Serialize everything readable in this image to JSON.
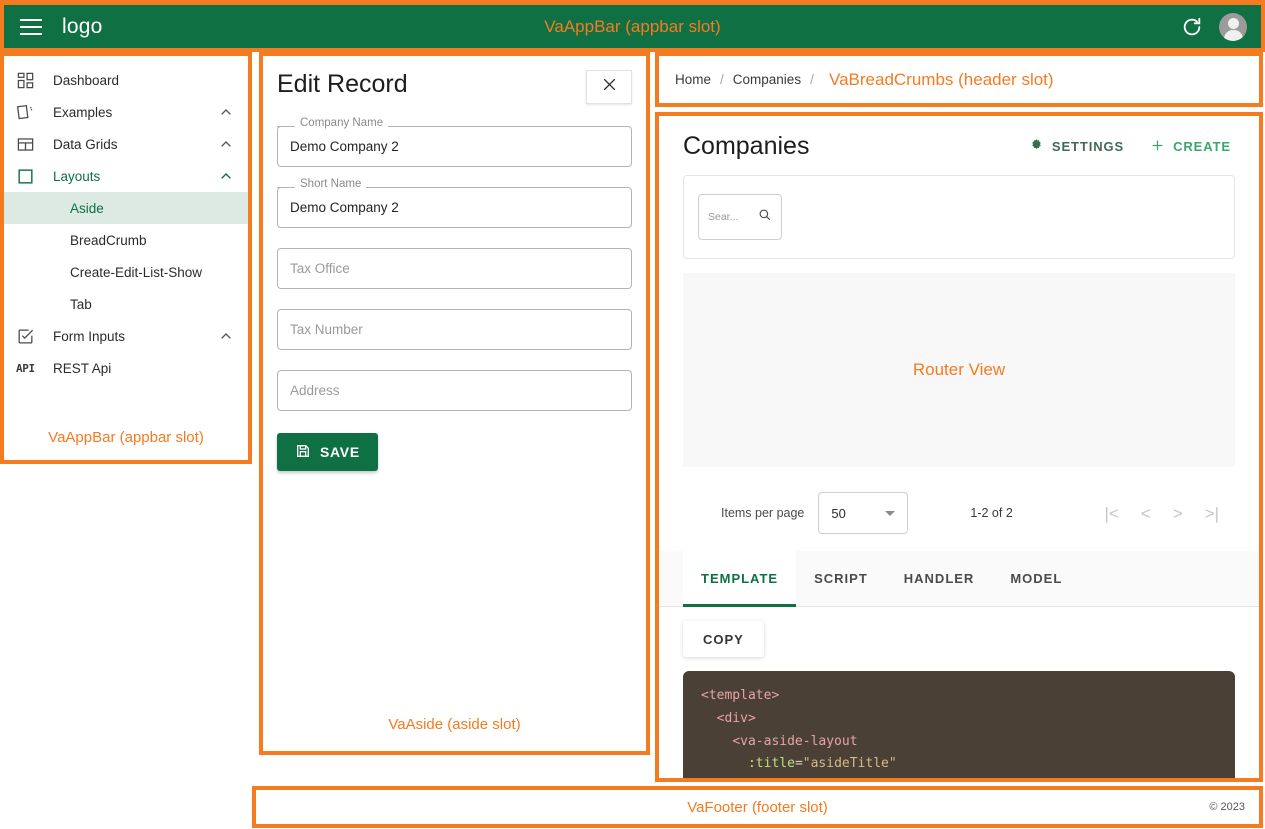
{
  "appbar": {
    "logo": "logo",
    "center_note": "VaAppBar (appbar slot)",
    "menu_icon": "hamburger-icon",
    "refresh_icon": "refresh-icon",
    "avatar_icon": "avatar"
  },
  "sidebar": {
    "note": "VaAppBar (appbar slot)",
    "items": [
      {
        "label": "Dashboard",
        "icon": "dashboard-grid-icon",
        "expandable": false,
        "level": 0
      },
      {
        "label": "Examples",
        "icon": "cards-icon",
        "expandable": true,
        "level": 0
      },
      {
        "label": "Data Grids",
        "icon": "table-icon",
        "expandable": true,
        "level": 0
      },
      {
        "label": "Layouts",
        "icon": "square-icon",
        "expandable": true,
        "level": 0,
        "active": true
      },
      {
        "label": "Aside",
        "icon": "",
        "expandable": false,
        "level": 1,
        "selected": true
      },
      {
        "label": "BreadCrumb",
        "icon": "",
        "expandable": false,
        "level": 1
      },
      {
        "label": "Create-Edit-List-Show",
        "icon": "",
        "expandable": false,
        "level": 1
      },
      {
        "label": "Tab",
        "icon": "",
        "expandable": false,
        "level": 1
      },
      {
        "label": "Form Inputs",
        "icon": "checkbox-icon",
        "expandable": true,
        "level": 0
      },
      {
        "label": "REST Api",
        "icon": "api-icon",
        "expandable": false,
        "level": 0
      }
    ]
  },
  "aside": {
    "title": "Edit Record",
    "close_icon": "close-icon",
    "note": "VaAside (aside slot)",
    "fields": [
      {
        "label": "Company Name",
        "value": "Demo Company 2",
        "floating": true
      },
      {
        "label": "Short Name",
        "value": "Demo Company 2",
        "floating": true
      },
      {
        "label": "",
        "placeholder": "Tax Office",
        "value": "",
        "floating": false
      },
      {
        "label": "",
        "placeholder": "Tax Number",
        "value": "",
        "floating": false
      },
      {
        "label": "",
        "placeholder": "Address",
        "value": "",
        "floating": false
      }
    ],
    "save_label": "SAVE",
    "save_icon": "save-floppy-icon"
  },
  "header": {
    "crumbs": [
      "Home",
      "Companies"
    ],
    "separator": "/",
    "note": "VaBreadCrumbs (header slot)"
  },
  "main": {
    "title": "Companies",
    "settings_label": "SETTINGS",
    "settings_icon": "gear-icon",
    "create_label": "CREATE",
    "create_icon": "plus-icon",
    "search_placeholder": "Sear...",
    "search_icon": "search-icon",
    "router_view_note": "Router View",
    "pager": {
      "items_per_page_label": "Items per page",
      "per_page_value": "50",
      "range": "1-2 of 2",
      "first": "|<",
      "prev": "<",
      "next": ">",
      "last": ">|"
    },
    "tabs": [
      {
        "label": "TEMPLATE",
        "active": true
      },
      {
        "label": "SCRIPT",
        "active": false
      },
      {
        "label": "HANDLER",
        "active": false
      },
      {
        "label": "MODEL",
        "active": false
      }
    ],
    "copy_label": "COPY",
    "code_lines": [
      {
        "indent": 0,
        "segments": [
          {
            "t": "<template>",
            "c": "tag"
          }
        ]
      },
      {
        "indent": 1,
        "segments": [
          {
            "t": "<div>",
            "c": "tag"
          }
        ]
      },
      {
        "indent": 2,
        "segments": [
          {
            "t": "<va-aside-layout",
            "c": "tag"
          }
        ]
      },
      {
        "indent": 3,
        "segments": [
          {
            "t": ":title",
            "c": "attr"
          },
          {
            "t": "=",
            "c": "punct"
          },
          {
            "t": "\"asideTitle\"",
            "c": "str"
          }
        ]
      }
    ]
  },
  "footer": {
    "note": "VaFooter (footer slot)",
    "copyright": "© 2023"
  },
  "colors": {
    "brand_green": "#0f7044",
    "annotation_orange": "#f47b20",
    "code_bg": "#4a4036",
    "active_item_bg": "#dceae3"
  }
}
